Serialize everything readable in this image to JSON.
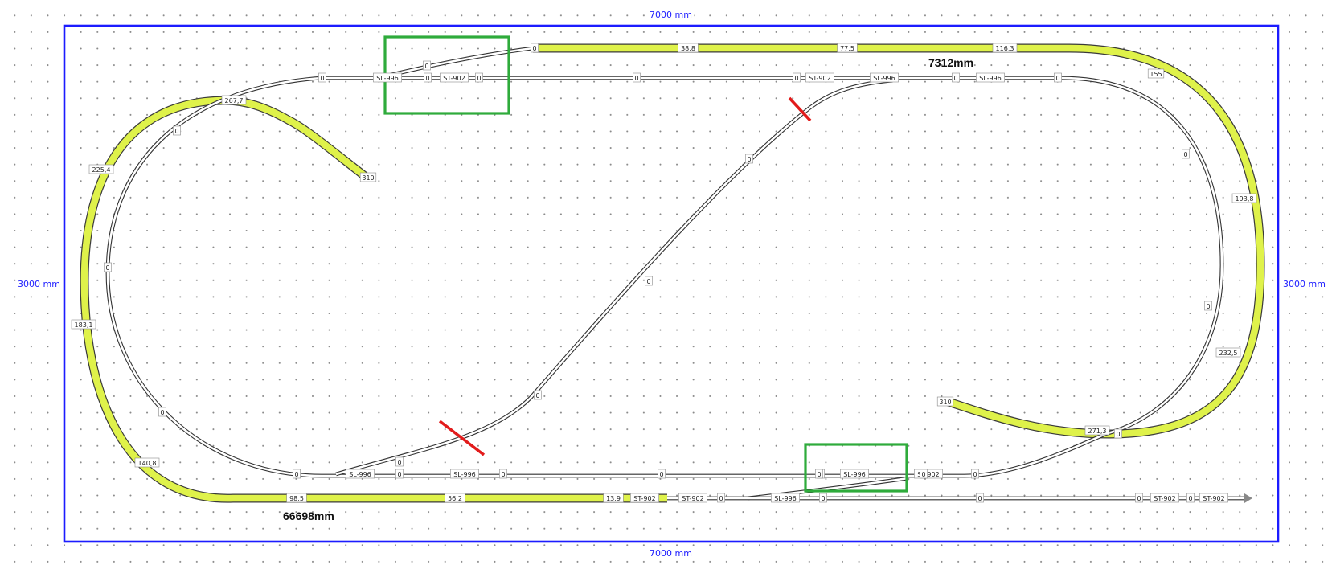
{
  "dimensions": {
    "top": "7000 mm",
    "bottom": "7000 mm",
    "left": "3000 mm",
    "right": "3000 mm"
  },
  "track_lengths": {
    "upper": "7312mm",
    "lower": "66698mm"
  },
  "colors": {
    "frame": "#1c1cff",
    "elevated_track": "#dff24a",
    "track": "#ffffff",
    "highlight_box": "#2eab3b",
    "cut_mark": "#e21b1b"
  },
  "elevation_labels": {
    "top_1": "38,8",
    "top_2": "77,5",
    "top_3": "116,3",
    "right_1": "155",
    "right_2": "193,8",
    "right_3": "232,5",
    "right_4": "271,3",
    "left_1": "267,7",
    "left_2": "225,4",
    "left_3": "183,1",
    "left_4": "140,8",
    "bottom_1": "98,5",
    "bottom_2": "56,2",
    "bottom_3": "13,9",
    "end_left": "310",
    "end_right": "310"
  },
  "track_labels": {
    "top_sl_1": "SL-996",
    "top_st_1": "ST-902",
    "top_st_2": "ST-902",
    "top_sl_2": "SL-996",
    "top_sl_3": "SL-996",
    "bot_sl_1": "SL-996",
    "bot_sl_2": "SL-996",
    "bot_sl_3": "SL-996",
    "bot_st_1": "ST-902",
    "bot_st_2": "ST-902",
    "bot_st_3": "ST-902",
    "bot_sl_4": "SL-996",
    "bot_st_4": "ST-902",
    "bot_st_5": "ST-902"
  },
  "zero": "0"
}
